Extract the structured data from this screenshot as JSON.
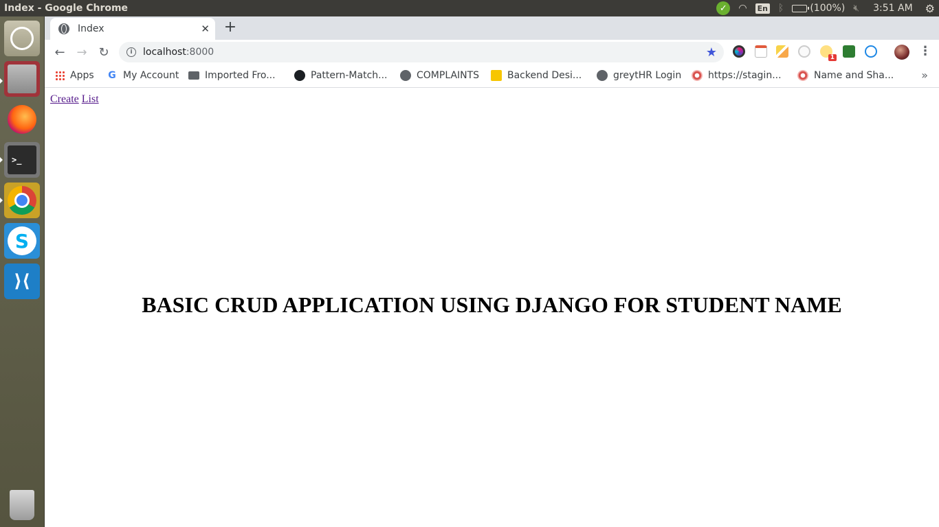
{
  "system": {
    "window_title": "Index - Google Chrome",
    "keyboard_layout": "En",
    "battery": "(100%)",
    "clock": "3:51 AM"
  },
  "launcher": {
    "items": [
      "ubuntu-dash",
      "files",
      "firefox",
      "terminal",
      "chrome",
      "skype",
      "vscode",
      "trash"
    ]
  },
  "browser": {
    "tab": {
      "title": "Index"
    },
    "url_host": "localhost",
    "url_port": ":8000",
    "extensions": {
      "badge_count": "1"
    },
    "bookmarks": [
      {
        "label": "Apps",
        "icon": "apps-icon"
      },
      {
        "label": "My Account",
        "icon": "google-icon"
      },
      {
        "label": "Imported Fro...",
        "icon": "folder-icon"
      },
      {
        "label": "Pattern-Match...",
        "icon": "github-icon"
      },
      {
        "label": "COMPLAINTS",
        "icon": "globe-icon"
      },
      {
        "label": "Backend Desi...",
        "icon": "slides-icon"
      },
      {
        "label": "greytHR Login",
        "icon": "globe-icon"
      },
      {
        "label": "https://stagin...",
        "icon": "flower-icon"
      },
      {
        "label": "Name and Sha...",
        "icon": "flower-icon"
      }
    ]
  },
  "page": {
    "links": {
      "create": "Create",
      "list": "List"
    },
    "heading": "BASIC CRUD APPLICATION USING DJANGO FOR STUDENT NAME"
  },
  "colors": {
    "link_visited": "#551a8b",
    "panel": "#3c3b37",
    "bookmark_star": "#4056d9"
  }
}
